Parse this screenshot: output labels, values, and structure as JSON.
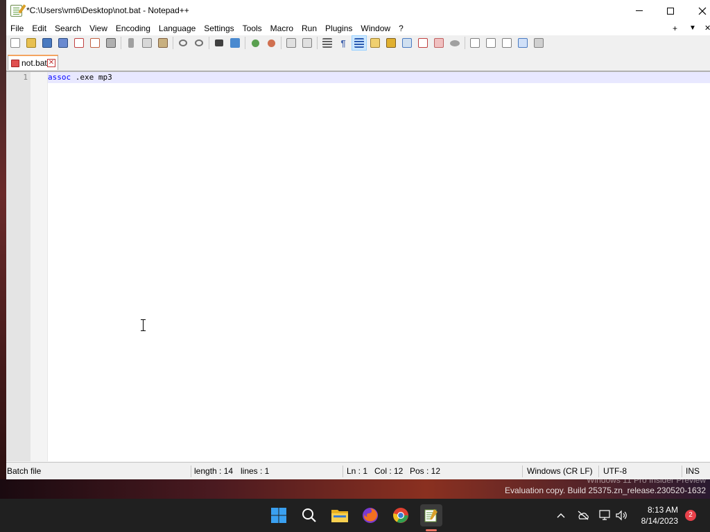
{
  "window": {
    "title": "*C:\\Users\\vm6\\Desktop\\not.bat - Notepad++"
  },
  "menu": {
    "items": [
      "File",
      "Edit",
      "Search",
      "View",
      "Encoding",
      "Language",
      "Settings",
      "Tools",
      "Macro",
      "Run",
      "Plugins",
      "Window",
      "?"
    ],
    "right_plus": "+",
    "right_down": "▼",
    "right_close": "✕"
  },
  "tab": {
    "label": "not.bat",
    "close": "✕"
  },
  "editor": {
    "line_number": "1",
    "keyword": "assoc",
    "rest": " .exe mp3"
  },
  "status": {
    "file_type": "Batch file",
    "length": "length : 14",
    "lines": "lines : 1",
    "ln": "Ln : 1",
    "col": "Col : 12",
    "pos": "Pos : 12",
    "eol": "Windows (CR LF)",
    "encoding": "UTF-8",
    "mode": "INS"
  },
  "watermark": {
    "line1": "Windows 11 Pro Insider Preview",
    "line2": "Evaluation copy. Build 25375.zn_release.230520-1632"
  },
  "taskbar": {
    "time": "8:13 AM",
    "date": "8/14/2023",
    "notification_count": "2"
  },
  "colors": {
    "keyword": "#0000ff",
    "current_line": "#e8e8ff",
    "tab_accent": "#f4a460",
    "taskbar": "#202020"
  }
}
